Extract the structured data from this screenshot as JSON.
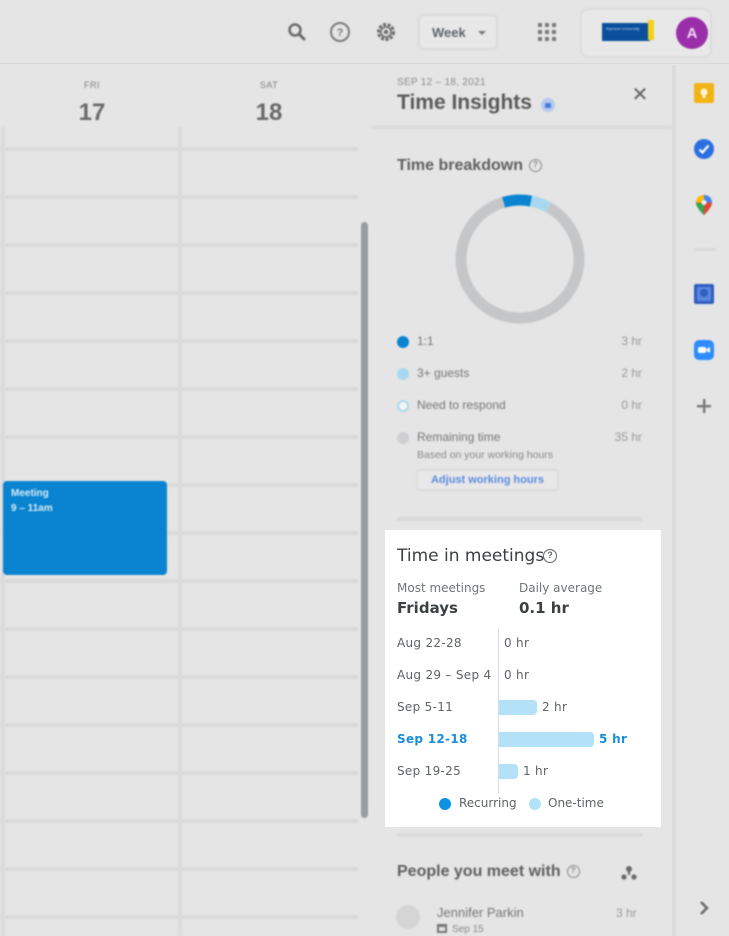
{
  "topbar": {
    "icons": [
      "search-icon",
      "help-icon",
      "settings-icon",
      "apps-grid-icon"
    ],
    "view_select": {
      "selected": "Week"
    },
    "org_logo_text": "Ryerson University",
    "avatar_initial": "A"
  },
  "calendar": {
    "days": [
      {
        "dow": "FRI",
        "date": "17"
      },
      {
        "dow": "SAT",
        "date": "18"
      }
    ],
    "events": [
      {
        "title": "Meeting",
        "time": "9 – 11am",
        "color": "#0a84d0"
      }
    ]
  },
  "insights": {
    "date_range": "SEP 12 – 18, 2021",
    "title": "Time Insights",
    "time_breakdown": {
      "title": "Time breakdown",
      "items": [
        {
          "label": "1:1",
          "value": "3 hr",
          "color": "#0a84d0"
        },
        {
          "label": "3+ guests",
          "value": "2 hr",
          "color": "#a8d8f0"
        },
        {
          "label": "Need to respond",
          "value": "0 hr",
          "color": "outline"
        },
        {
          "label": "Remaining time",
          "value": "35 hr",
          "color": "#c8c8c8"
        }
      ],
      "remaining_note": "Based on your working hours",
      "adjust_button": "Adjust working hours"
    },
    "time_in_meetings": {
      "title": "Time in meetings",
      "most_meetings_label": "Most meetings",
      "most_meetings_value": "Fridays",
      "daily_average_label": "Daily average",
      "daily_average_value": "0.1 hr",
      "legend": [
        {
          "label": "Recurring",
          "color": "#0b92e2"
        },
        {
          "label": "One-time",
          "color": "#b3e1f7"
        }
      ]
    },
    "people": {
      "title": "People you meet with",
      "list": [
        {
          "name": "Jennifer Parkin",
          "date": "Sep 15",
          "hours": "3 hr"
        }
      ]
    }
  },
  "chart_data": {
    "type": "bar",
    "orientation": "horizontal",
    "title": "Time in meetings",
    "categories": [
      "Aug 22-28",
      "Aug 29 – Sep 4",
      "Sep 5-11",
      "Sep 12-18",
      "Sep 19-25"
    ],
    "values": [
      0,
      0,
      2,
      5,
      1
    ],
    "value_labels": [
      "0 hr",
      "0 hr",
      "2 hr",
      "5 hr",
      "1 hr"
    ],
    "highlighted": "Sep 12-18",
    "unit": "hr",
    "xlim": [
      0,
      5
    ],
    "series": [
      {
        "name": "One-time",
        "values": [
          0,
          0,
          2,
          5,
          1
        ]
      },
      {
        "name": "Recurring",
        "values": [
          0,
          0,
          0,
          0,
          0
        ]
      }
    ],
    "legend": "bottom"
  },
  "donut_data": {
    "type": "pie",
    "segments": [
      {
        "label": "1:1",
        "value": 3,
        "color": "#0a84d0"
      },
      {
        "label": "3+ guests",
        "value": 2,
        "color": "#a8d8f0"
      },
      {
        "label": "Need to respond",
        "value": 0,
        "color": "#ffffff"
      },
      {
        "label": "Remaining time",
        "value": 35,
        "color": "#c5c6c8"
      }
    ]
  },
  "rail": {
    "icons": [
      "keep-icon",
      "tasks-icon",
      "maps-icon",
      "contacts-icon",
      "zoom-icon",
      "add-icon",
      "expand-chevron-icon"
    ]
  }
}
